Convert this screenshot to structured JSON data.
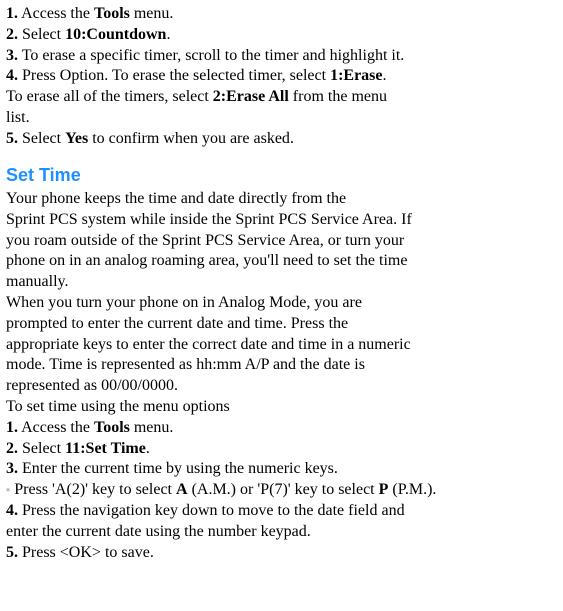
{
  "section1": {
    "step1": {
      "num": "1.",
      "pre": " Access the ",
      "bold": "Tools",
      "post": " menu."
    },
    "step2": {
      "num": "2.",
      "pre": " Select ",
      "bold": "10:Countdown",
      "post": "."
    },
    "step3": {
      "num": "3.",
      "text": " To erase a specific timer, scroll to the timer and highlight it."
    },
    "step4": {
      "num": "4.",
      "pre": " Press Option. To erase the selected timer, select ",
      "bold": "1:Erase",
      "post": "."
    },
    "line5a": "To erase all of the timers, select ",
    "line5bold": "2:Erase All",
    "line5b": " from the menu",
    "line6": "list.",
    "step5": {
      "num": "5.",
      "pre": " Select ",
      "bold": "Yes",
      "post": " to confirm when you are asked."
    }
  },
  "section2": {
    "heading": "Set Time",
    "para1_l1": "Your phone keeps the time and date directly from the",
    "para1_l2": "Sprint PCS system while inside the Sprint PCS Service Area. If",
    "para1_l3": "you roam outside of the Sprint PCS Service Area, or turn your",
    "para1_l4": "phone on in an analog roaming area, you'll need to set the time",
    "para1_l5": "manually.",
    "para2_l1": "When you turn your phone on in Analog Mode, you are",
    "para2_l2": "prompted to enter the current date and time. Press the",
    "para2_l3": "appropriate keys to enter the correct date and time in a numeric",
    "para2_l4": "mode. Time is represented as hh:mm A/P and the date is",
    "para2_l5": "represented as 00/00/0000.",
    "intro": "To set time using the menu options",
    "step1": {
      "num": "1.",
      "pre": " Access the ",
      "bold": "Tools",
      "post": " menu."
    },
    "step2": {
      "num": "2.",
      "pre": " Select ",
      "bold": "11:Set Time",
      "post": "."
    },
    "step3": {
      "num": "3.",
      "text": " Enter the current time by using the numeric keys."
    },
    "bullet": {
      "lead": " Press 'A(2)' key to select ",
      "boldA": "A",
      "mid": " (A.M.) or    'P(7)' key to select ",
      "boldP": "P",
      "post": " (P.M.)."
    },
    "step4_l1": {
      "num": "4.",
      "text": " Press the navigation key down to move to the date field and"
    },
    "step4_l2": "enter the current date using the number keypad.",
    "step5": {
      "num": "5.",
      "text": " Press <OK> to save."
    }
  }
}
